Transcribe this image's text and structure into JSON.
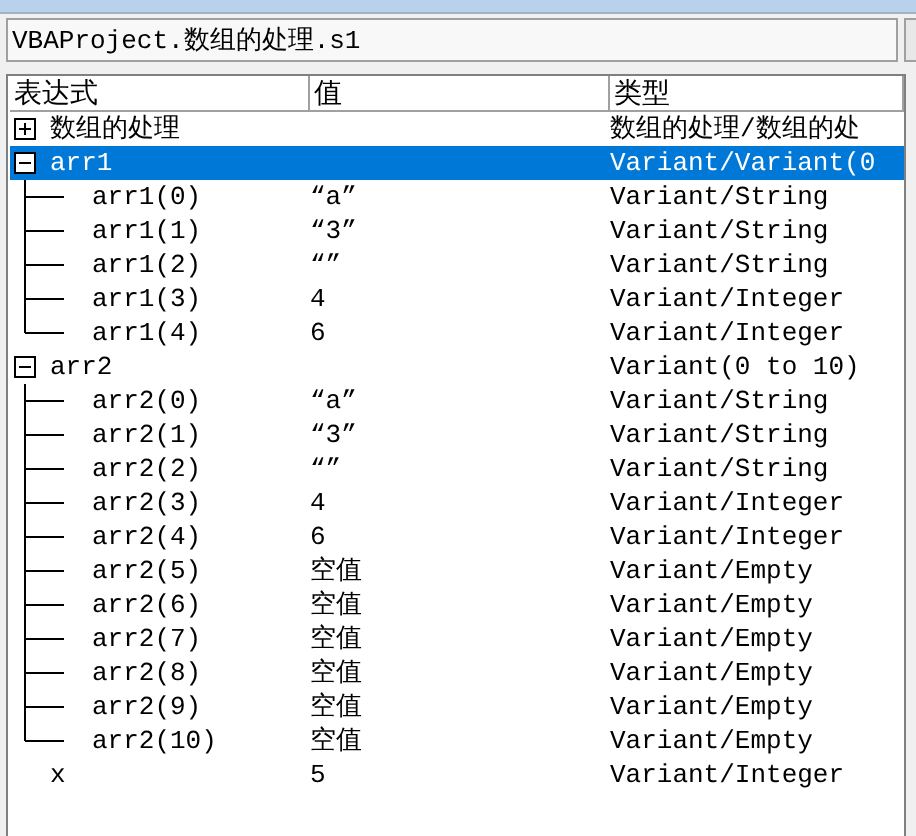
{
  "context": {
    "value": "VBAProject.数组的处理.s1"
  },
  "columns": [
    "表达式",
    "值",
    "类型"
  ],
  "rows": [
    {
      "kind": "node",
      "expression": "数组的处理",
      "type": "数组的处理/数组的处",
      "expanded": false,
      "selected": false,
      "children": []
    },
    {
      "kind": "node",
      "expression": "arr1",
      "type": "Variant/Variant(0",
      "expanded": true,
      "selected": true,
      "children": [
        {
          "expression": "arr1(0)",
          "value": "“a”",
          "type": "Variant/String",
          "selected": false
        },
        {
          "expression": "arr1(1)",
          "value": "“3”",
          "type": "Variant/String",
          "selected": false
        },
        {
          "expression": "arr1(2)",
          "value": "“”",
          "type": "Variant/String",
          "selected": false
        },
        {
          "expression": "arr1(3)",
          "value": "4",
          "type": "Variant/Integer",
          "selected": false
        },
        {
          "expression": "arr1(4)",
          "value": "6",
          "type": "Variant/Integer",
          "selected": false
        }
      ]
    },
    {
      "kind": "node",
      "expression": "arr2",
      "type": "Variant(0 to 10)",
      "expanded": true,
      "selected": false,
      "children": [
        {
          "expression": "arr2(0)",
          "value": "“a”",
          "type": "Variant/String",
          "selected": false
        },
        {
          "expression": "arr2(1)",
          "value": "“3”",
          "type": "Variant/String",
          "selected": false
        },
        {
          "expression": "arr2(2)",
          "value": "“”",
          "type": "Variant/String",
          "selected": false
        },
        {
          "expression": "arr2(3)",
          "value": "4",
          "type": "Variant/Integer",
          "selected": false
        },
        {
          "expression": "arr2(4)",
          "value": "6",
          "type": "Variant/Integer",
          "selected": false
        },
        {
          "expression": "arr2(5)",
          "value": "空值",
          "type": "Variant/Empty",
          "selected": false
        },
        {
          "expression": "arr2(6)",
          "value": "空值",
          "type": "Variant/Empty",
          "selected": false
        },
        {
          "expression": "arr2(7)",
          "value": "空值",
          "type": "Variant/Empty",
          "selected": false
        },
        {
          "expression": "arr2(8)",
          "value": "空值",
          "type": "Variant/Empty",
          "selected": false
        },
        {
          "expression": "arr2(9)",
          "value": "空值",
          "type": "Variant/Empty",
          "selected": false
        },
        {
          "expression": "arr2(10)",
          "value": "空值",
          "type": "Variant/Empty",
          "selected": false
        }
      ]
    },
    {
      "kind": "leaf",
      "expression": "x",
      "value": "5",
      "type": "Variant/Integer",
      "selected": false
    }
  ]
}
